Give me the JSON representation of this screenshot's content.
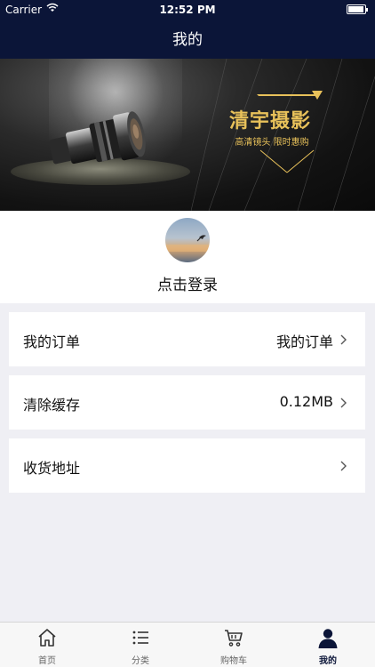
{
  "status_bar": {
    "carrier": "Carrier",
    "time": "12:52 PM"
  },
  "nav": {
    "title": "我的"
  },
  "banner": {
    "brand": "清宇摄影",
    "slogan": "高清镜头 限时惠购"
  },
  "profile": {
    "login_label": "点击登录"
  },
  "menu": {
    "orders": {
      "label": "我的订单",
      "value": "我的订单"
    },
    "cache": {
      "label": "清除缓存",
      "value": "0.12MB"
    },
    "address": {
      "label": "收货地址",
      "value": ""
    }
  },
  "tabbar": {
    "items": [
      {
        "label": "首页",
        "icon": "home-icon"
      },
      {
        "label": "分类",
        "icon": "list-icon"
      },
      {
        "label": "购物车",
        "icon": "cart-icon"
      },
      {
        "label": "我的",
        "icon": "user-icon"
      }
    ],
    "active_index": 3
  },
  "colors": {
    "nav_bg": "#0b1538",
    "page_bg": "#efeff4",
    "brand_gold": "#e8c15a",
    "tab_active": "#0b1538"
  }
}
